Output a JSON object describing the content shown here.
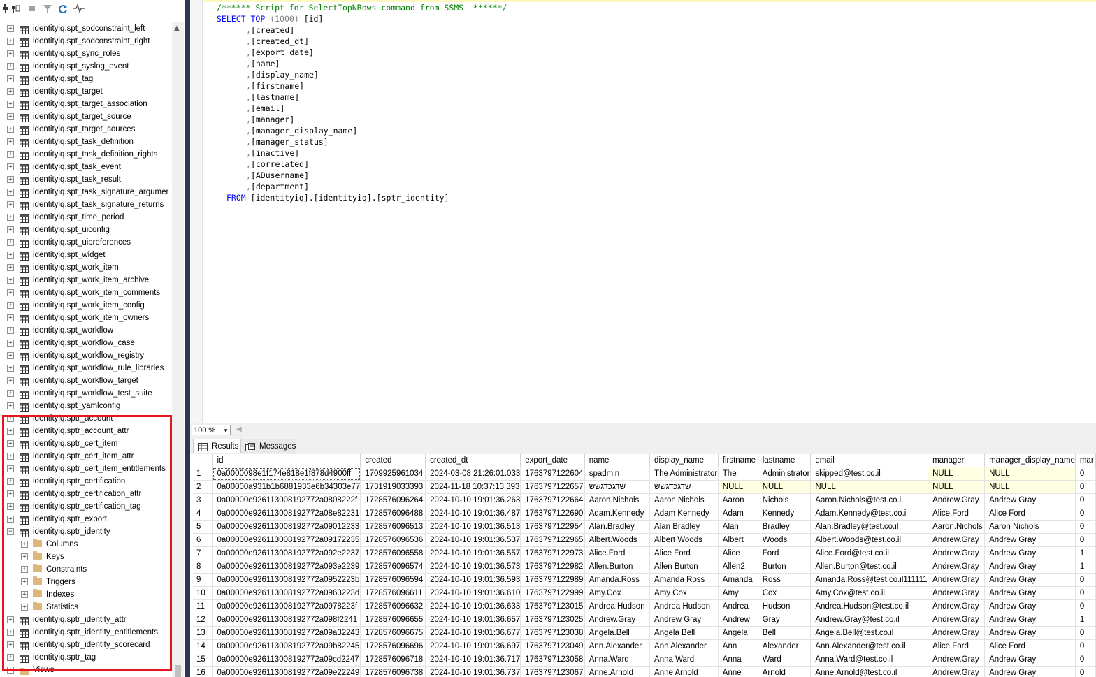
{
  "object_explorer": {
    "toolbar": [
      "connect-icon",
      "connect-object-icon",
      "disconnect-icon",
      "stop-icon",
      "filter-icon",
      "refresh-icon",
      "activity-icon"
    ],
    "tables_before": [
      "identityiq.spt_sodconstraint_left",
      "identityiq.spt_sodconstraint_right",
      "identityiq.spt_sync_roles",
      "identityiq.spt_syslog_event",
      "identityiq.spt_tag",
      "identityiq.spt_target",
      "identityiq.spt_target_association",
      "identityiq.spt_target_source",
      "identityiq.spt_target_sources",
      "identityiq.spt_task_definition",
      "identityiq.spt_task_definition_rights",
      "identityiq.spt_task_event",
      "identityiq.spt_task_result",
      "identityiq.spt_task_signature_argumer",
      "identityiq.spt_task_signature_returns",
      "identityiq.spt_time_period",
      "identityiq.spt_uiconfig",
      "identityiq.spt_uipreferences",
      "identityiq.spt_widget",
      "identityiq.spt_work_item",
      "identityiq.spt_work_item_archive",
      "identityiq.spt_work_item_comments",
      "identityiq.spt_work_item_config",
      "identityiq.spt_work_item_owners",
      "identityiq.spt_workflow",
      "identityiq.spt_workflow_case",
      "identityiq.spt_workflow_registry",
      "identityiq.spt_workflow_rule_libraries",
      "identityiq.spt_workflow_target",
      "identityiq.spt_workflow_test_suite",
      "identityiq.spt_yamlconfig",
      "identityiq.sptr_account",
      "identityiq.sptr_account_attr",
      "identityiq.sptr_cert_item",
      "identityiq.sptr_cert_item_attr",
      "identityiq.sptr_cert_item_entitlements",
      "identityiq.sptr_certification",
      "identityiq.sptr_certification_attr",
      "identityiq.sptr_certification_tag",
      "identityiq.sptr_export",
      "identityiq.sptr_identity"
    ],
    "identity_children": [
      "Columns",
      "Keys",
      "Constraints",
      "Triggers",
      "Indexes",
      "Statistics"
    ],
    "tables_after": [
      "identityiq.sptr_identity_attr",
      "identityiq.sptr_identity_entitlements",
      "identityiq.sptr_identity_scorecard",
      "identityiq.sptr_tag"
    ],
    "views_label": "Views"
  },
  "editor": {
    "comment": "/****** Script for SelectTopNRows command from SSMS  ******/",
    "select_kw": "SELECT",
    "top_kw": "TOP",
    "top_n": "(1000)",
    "first_column": "[id]",
    "columns": [
      "[created]",
      "[created_dt]",
      "[export_date]",
      "[name]",
      "[display_name]",
      "[firstname]",
      "[lastname]",
      "[email]",
      "[manager]",
      "[manager_display_name]",
      "[manager_status]",
      "[inactive]",
      "[correlated]",
      "[ADusername]",
      "[department]"
    ],
    "from_kw": "FROM",
    "from_target": "[identityiq].[identityiq].[sptr_identity]"
  },
  "zoom": "100 %",
  "tabs": [
    "Results",
    "Messages"
  ],
  "results": {
    "headers": [
      "id",
      "created",
      "created_dt",
      "export_date",
      "name",
      "display_name",
      "firstname",
      "lastname",
      "email",
      "manager",
      "manager_display_name",
      "mar"
    ],
    "rows": [
      [
        "1",
        "0a0000098e1f174e818e1f878d4900ff",
        "1709925961034",
        "2024-03-08 21:26:01.033",
        "1763797122604",
        "spadmin",
        "The Administrator",
        "The",
        "Administrator",
        "skipped@test.co.il",
        "NULL",
        "NULL",
        "0"
      ],
      [
        "2",
        "0a00000a931b1b6881933e6b34303e77",
        "1731919033393",
        "2024-11-18 10:37:13.393",
        "1763797122657",
        "שדגכדגשש",
        "שדגכדגשש",
        "NULL",
        "NULL",
        "NULL",
        "NULL",
        "NULL",
        "0"
      ],
      [
        "3",
        "0a00000e926113008192772a0808222f",
        "1728576096264",
        "2024-10-10 19:01:36.263",
        "1763797122664",
        "Aaron.Nichols",
        "Aaron Nichols",
        "Aaron",
        "Nichols",
        "Aaron.Nichols@test.co.il",
        "Andrew.Gray",
        "Andrew Gray",
        "0"
      ],
      [
        "4",
        "0a00000e926113008192772a08e82231",
        "1728576096488",
        "2024-10-10 19:01:36.487",
        "1763797122690",
        "Adam.Kennedy",
        "Adam Kennedy",
        "Adam",
        "Kennedy",
        "Adam.Kennedy@test.co.il",
        "Alice.Ford",
        "Alice Ford",
        "0"
      ],
      [
        "5",
        "0a00000e926113008192772a09012233",
        "1728576096513",
        "2024-10-10 19:01:36.513",
        "1763797122954",
        "Alan.Bradley",
        "Alan Bradley",
        "Alan",
        "Bradley",
        "Alan.Bradley@test.co.il",
        "Aaron.Nichols",
        "Aaron Nichols",
        "0"
      ],
      [
        "6",
        "0a00000e926113008192772a09172235",
        "1728576096536",
        "2024-10-10 19:01:36.537",
        "1763797122965",
        "Albert.Woods",
        "Albert Woods",
        "Albert",
        "Woods",
        "Albert.Woods@test.co.il",
        "Andrew.Gray",
        "Andrew Gray",
        "0"
      ],
      [
        "7",
        "0a00000e926113008192772a092e2237",
        "1728576096558",
        "2024-10-10 19:01:36.557",
        "1763797122973",
        "Alice.Ford",
        "Alice Ford",
        "Alice",
        "Ford",
        "Alice.Ford@test.co.il",
        "Andrew.Gray",
        "Andrew Gray",
        "1"
      ],
      [
        "8",
        "0a00000e926113008192772a093e2239",
        "1728576096574",
        "2024-10-10 19:01:36.573",
        "1763797122982",
        "Allen.Burton",
        "Allen Burton",
        "Allen2",
        "Burton",
        "Allen.Burton@test.co.il",
        "Andrew.Gray",
        "Andrew Gray",
        "1"
      ],
      [
        "9",
        "0a00000e926113008192772a0952223b",
        "1728576096594",
        "2024-10-10 19:01:36.593",
        "1763797122989",
        "Amanda.Ross",
        "Amanda Ross",
        "Amanda",
        "Ross",
        "Amanda.Ross@test.co.il111111",
        "Andrew.Gray",
        "Andrew Gray",
        "0"
      ],
      [
        "10",
        "0a00000e926113008192772a0963223d",
        "1728576096611",
        "2024-10-10 19:01:36.610",
        "1763797122999",
        "Amy.Cox",
        "Amy Cox",
        "Amy",
        "Cox",
        "Amy.Cox@test.co.il",
        "Andrew.Gray",
        "Andrew Gray",
        "0"
      ],
      [
        "11",
        "0a00000e926113008192772a0978223f",
        "1728576096632",
        "2024-10-10 19:01:36.633",
        "1763797123015",
        "Andrea.Hudson",
        "Andrea Hudson",
        "Andrea",
        "Hudson",
        "Andrea.Hudson@test.co.il",
        "Andrew.Gray",
        "Andrew Gray",
        "0"
      ],
      [
        "12",
        "0a00000e926113008192772a098f2241",
        "1728576096655",
        "2024-10-10 19:01:36.657",
        "1763797123025",
        "Andrew.Gray",
        "Andrew Gray",
        "Andrew",
        "Gray",
        "Andrew.Gray@test.co.il",
        "Andrew.Gray",
        "Andrew Gray",
        "1"
      ],
      [
        "13",
        "0a00000e926113008192772a09a32243",
        "1728576096675",
        "2024-10-10 19:01:36.677",
        "1763797123038",
        "Angela.Bell",
        "Angela Bell",
        "Angela",
        "Bell",
        "Angela.Bell@test.co.il",
        "Andrew.Gray",
        "Andrew Gray",
        "0"
      ],
      [
        "14",
        "0a00000e926113008192772a09b82245",
        "1728576096696",
        "2024-10-10 19:01:36.697",
        "1763797123049",
        "Ann.Alexander",
        "Ann Alexander",
        "Ann",
        "Alexander",
        "Ann.Alexander@test.co.il",
        "Alice.Ford",
        "Alice Ford",
        "0"
      ],
      [
        "15",
        "0a00000e926113008192772a09cd2247",
        "1728576096718",
        "2024-10-10 19:01:36.717",
        "1763797123058",
        "Anna.Ward",
        "Anna Ward",
        "Anna",
        "Ward",
        "Anna.Ward@test.co.il",
        "Andrew.Gray",
        "Andrew Gray",
        "0"
      ],
      [
        "16",
        "0a00000e926113008192772a09e22249",
        "1728576096738",
        "2024-10-10 19:01:36.737",
        "1763797123067",
        "Anne.Arnold",
        "Anne Arnold",
        "Anne",
        "Arnold",
        "Anne.Arnold@test.co.il",
        "Andrew.Gray",
        "Andrew Gray",
        "0"
      ]
    ]
  },
  "colors": {
    "highlight": "#e8141e",
    "splitter": "#293955",
    "keyword": "#0000ff",
    "comment": "#008000",
    "null_bg": "#ffffe1"
  }
}
